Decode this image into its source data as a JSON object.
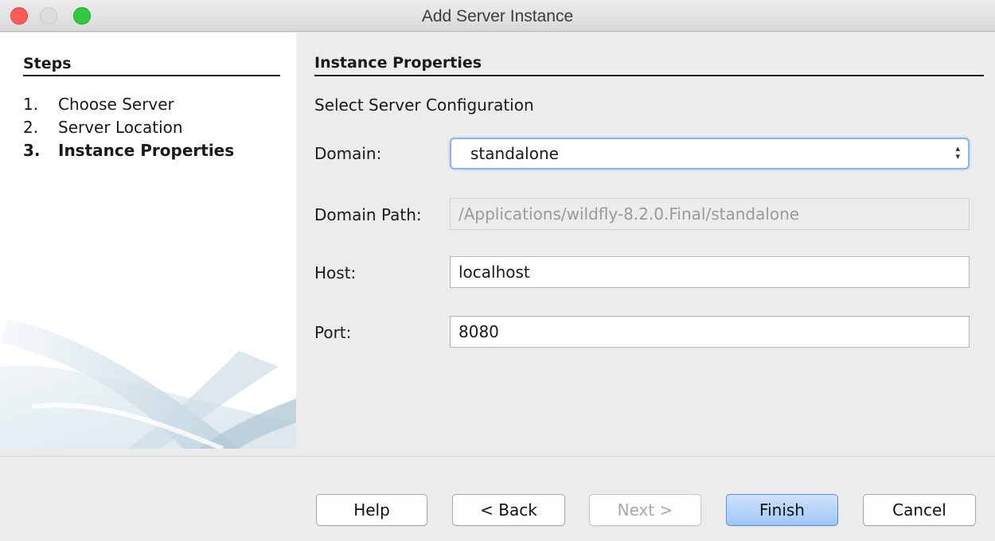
{
  "window": {
    "title": "Add Server Instance"
  },
  "steps": {
    "title": "Steps",
    "items": [
      {
        "num": "1.",
        "label": "Choose Server"
      },
      {
        "num": "2.",
        "label": "Server Location"
      },
      {
        "num": "3.",
        "label": "Instance Properties"
      }
    ]
  },
  "main": {
    "title": "Instance Properties",
    "subtitle": "Select Server Configuration",
    "domain": {
      "label": "Domain:",
      "value": "standalone"
    },
    "domain_path": {
      "label": "Domain Path:",
      "value": "/Applications/wildfly-8.2.0.Final/standalone"
    },
    "host": {
      "label": "Host:",
      "value": "localhost"
    },
    "port": {
      "label": "Port:",
      "value": "8080"
    }
  },
  "buttons": {
    "help": "Help",
    "back": "< Back",
    "next": "Next >",
    "finish": "Finish",
    "cancel": "Cancel"
  },
  "icons": {
    "select_arrows": "up-down-arrows-icon"
  }
}
